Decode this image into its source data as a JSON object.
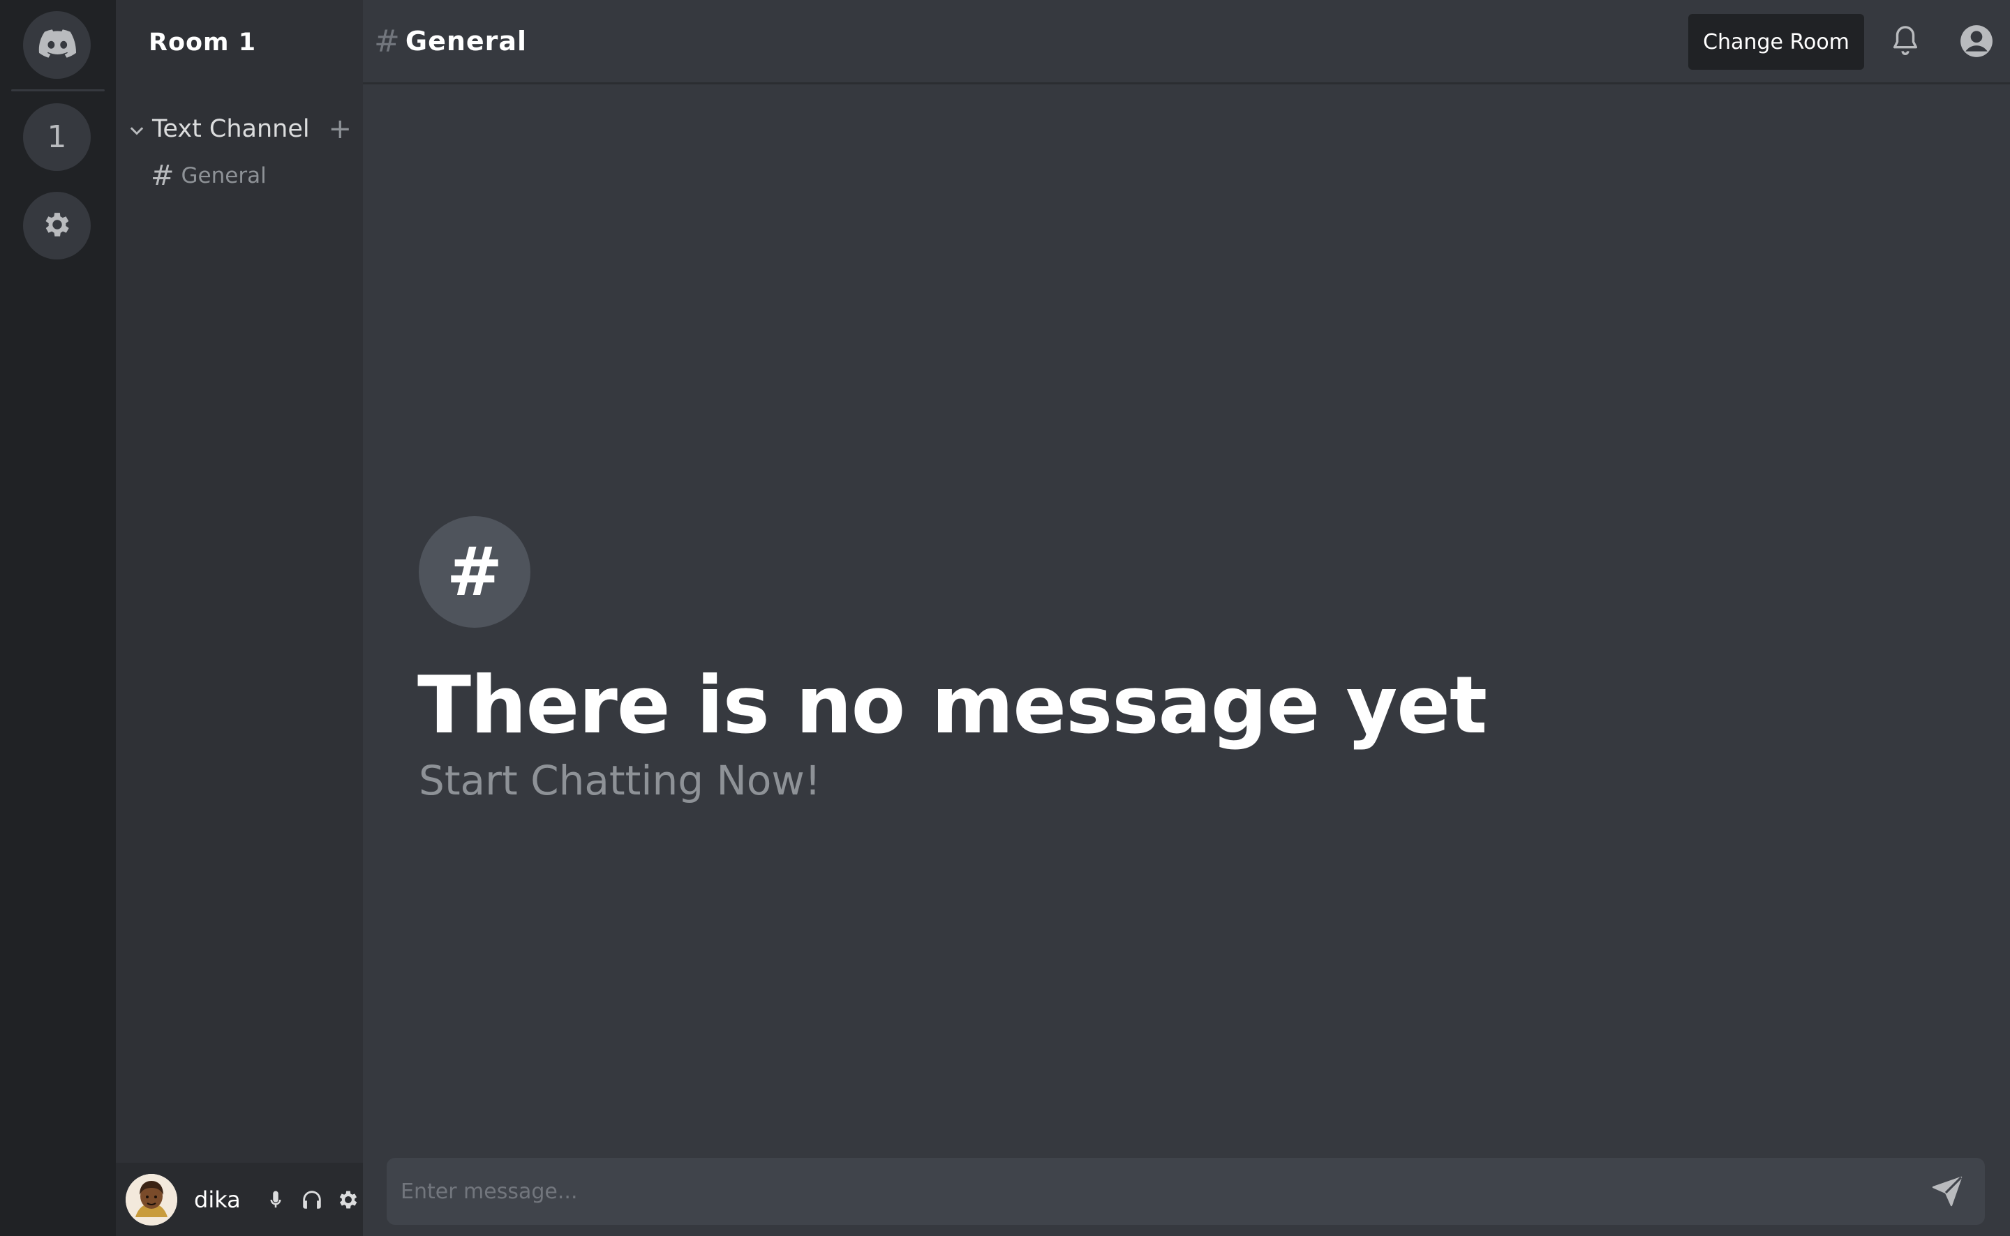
{
  "rail": {
    "room_number": "1"
  },
  "sidebar": {
    "room_name": "Room 1",
    "category_label": "Text Channel",
    "add_symbol": "+",
    "channels": [
      {
        "hash": "#",
        "label": "General"
      }
    ]
  },
  "user": {
    "name": "dika"
  },
  "header": {
    "hash": "#",
    "channel_title": "General",
    "change_room_label": "Change Room"
  },
  "empty_state": {
    "icon_symbol": "#",
    "title": "There is no message yet",
    "subtitle": "Start Chatting Now!"
  },
  "composer": {
    "placeholder": "Enter message..."
  },
  "colors": {
    "rail_bg": "#202225",
    "sidebar_bg": "#2f3136",
    "main_bg": "#36393f",
    "input_bg": "#40444b",
    "muted_text": "#8e9297"
  }
}
